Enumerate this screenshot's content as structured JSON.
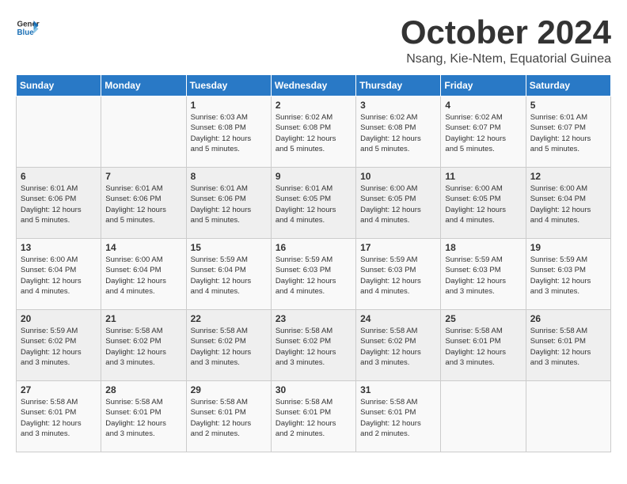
{
  "logo": {
    "line1": "General",
    "line2": "Blue"
  },
  "title": "October 2024",
  "subtitle": "Nsang, Kie-Ntem, Equatorial Guinea",
  "days_of_week": [
    "Sunday",
    "Monday",
    "Tuesday",
    "Wednesday",
    "Thursday",
    "Friday",
    "Saturday"
  ],
  "weeks": [
    [
      {
        "day": "",
        "info": ""
      },
      {
        "day": "",
        "info": ""
      },
      {
        "day": "1",
        "info": "Sunrise: 6:03 AM\nSunset: 6:08 PM\nDaylight: 12 hours\nand 5 minutes."
      },
      {
        "day": "2",
        "info": "Sunrise: 6:02 AM\nSunset: 6:08 PM\nDaylight: 12 hours\nand 5 minutes."
      },
      {
        "day": "3",
        "info": "Sunrise: 6:02 AM\nSunset: 6:08 PM\nDaylight: 12 hours\nand 5 minutes."
      },
      {
        "day": "4",
        "info": "Sunrise: 6:02 AM\nSunset: 6:07 PM\nDaylight: 12 hours\nand 5 minutes."
      },
      {
        "day": "5",
        "info": "Sunrise: 6:01 AM\nSunset: 6:07 PM\nDaylight: 12 hours\nand 5 minutes."
      }
    ],
    [
      {
        "day": "6",
        "info": "Sunrise: 6:01 AM\nSunset: 6:06 PM\nDaylight: 12 hours\nand 5 minutes."
      },
      {
        "day": "7",
        "info": "Sunrise: 6:01 AM\nSunset: 6:06 PM\nDaylight: 12 hours\nand 5 minutes."
      },
      {
        "day": "8",
        "info": "Sunrise: 6:01 AM\nSunset: 6:06 PM\nDaylight: 12 hours\nand 5 minutes."
      },
      {
        "day": "9",
        "info": "Sunrise: 6:01 AM\nSunset: 6:05 PM\nDaylight: 12 hours\nand 4 minutes."
      },
      {
        "day": "10",
        "info": "Sunrise: 6:00 AM\nSunset: 6:05 PM\nDaylight: 12 hours\nand 4 minutes."
      },
      {
        "day": "11",
        "info": "Sunrise: 6:00 AM\nSunset: 6:05 PM\nDaylight: 12 hours\nand 4 minutes."
      },
      {
        "day": "12",
        "info": "Sunrise: 6:00 AM\nSunset: 6:04 PM\nDaylight: 12 hours\nand 4 minutes."
      }
    ],
    [
      {
        "day": "13",
        "info": "Sunrise: 6:00 AM\nSunset: 6:04 PM\nDaylight: 12 hours\nand 4 minutes."
      },
      {
        "day": "14",
        "info": "Sunrise: 6:00 AM\nSunset: 6:04 PM\nDaylight: 12 hours\nand 4 minutes."
      },
      {
        "day": "15",
        "info": "Sunrise: 5:59 AM\nSunset: 6:04 PM\nDaylight: 12 hours\nand 4 minutes."
      },
      {
        "day": "16",
        "info": "Sunrise: 5:59 AM\nSunset: 6:03 PM\nDaylight: 12 hours\nand 4 minutes."
      },
      {
        "day": "17",
        "info": "Sunrise: 5:59 AM\nSunset: 6:03 PM\nDaylight: 12 hours\nand 4 minutes."
      },
      {
        "day": "18",
        "info": "Sunrise: 5:59 AM\nSunset: 6:03 PM\nDaylight: 12 hours\nand 3 minutes."
      },
      {
        "day": "19",
        "info": "Sunrise: 5:59 AM\nSunset: 6:03 PM\nDaylight: 12 hours\nand 3 minutes."
      }
    ],
    [
      {
        "day": "20",
        "info": "Sunrise: 5:59 AM\nSunset: 6:02 PM\nDaylight: 12 hours\nand 3 minutes."
      },
      {
        "day": "21",
        "info": "Sunrise: 5:58 AM\nSunset: 6:02 PM\nDaylight: 12 hours\nand 3 minutes."
      },
      {
        "day": "22",
        "info": "Sunrise: 5:58 AM\nSunset: 6:02 PM\nDaylight: 12 hours\nand 3 minutes."
      },
      {
        "day": "23",
        "info": "Sunrise: 5:58 AM\nSunset: 6:02 PM\nDaylight: 12 hours\nand 3 minutes."
      },
      {
        "day": "24",
        "info": "Sunrise: 5:58 AM\nSunset: 6:02 PM\nDaylight: 12 hours\nand 3 minutes."
      },
      {
        "day": "25",
        "info": "Sunrise: 5:58 AM\nSunset: 6:01 PM\nDaylight: 12 hours\nand 3 minutes."
      },
      {
        "day": "26",
        "info": "Sunrise: 5:58 AM\nSunset: 6:01 PM\nDaylight: 12 hours\nand 3 minutes."
      }
    ],
    [
      {
        "day": "27",
        "info": "Sunrise: 5:58 AM\nSunset: 6:01 PM\nDaylight: 12 hours\nand 3 minutes."
      },
      {
        "day": "28",
        "info": "Sunrise: 5:58 AM\nSunset: 6:01 PM\nDaylight: 12 hours\nand 3 minutes."
      },
      {
        "day": "29",
        "info": "Sunrise: 5:58 AM\nSunset: 6:01 PM\nDaylight: 12 hours\nand 2 minutes."
      },
      {
        "day": "30",
        "info": "Sunrise: 5:58 AM\nSunset: 6:01 PM\nDaylight: 12 hours\nand 2 minutes."
      },
      {
        "day": "31",
        "info": "Sunrise: 5:58 AM\nSunset: 6:01 PM\nDaylight: 12 hours\nand 2 minutes."
      },
      {
        "day": "",
        "info": ""
      },
      {
        "day": "",
        "info": ""
      }
    ]
  ]
}
